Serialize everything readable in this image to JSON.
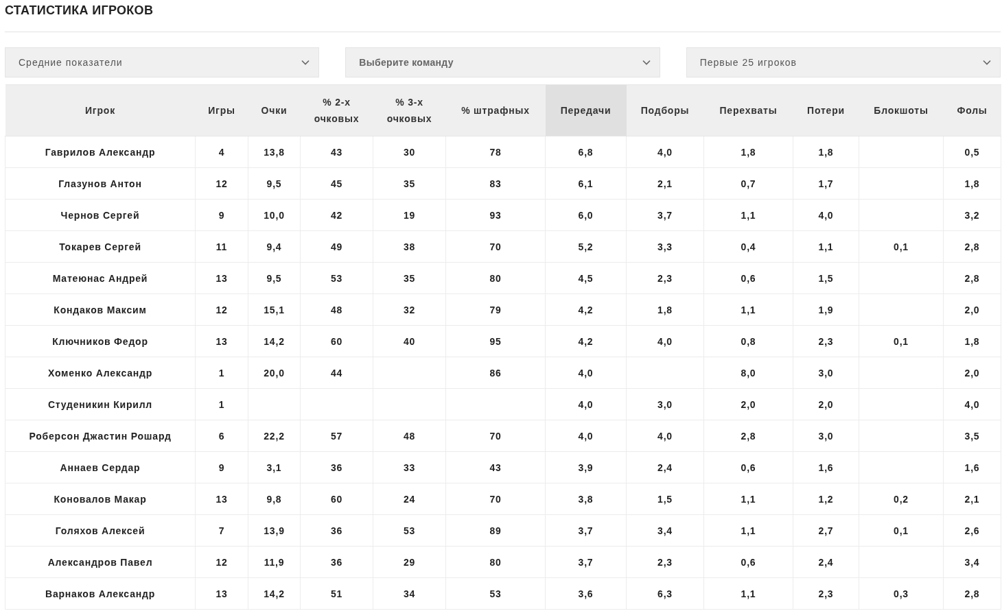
{
  "title": "СТАТИСТИКА ИГРОКОВ",
  "filters": [
    {
      "value": "Средние показатели"
    },
    {
      "placeholder": "Выберите команду"
    },
    {
      "value": "Первые 25 игроков"
    }
  ],
  "table": {
    "columns": [
      {
        "label": "Игрок",
        "selected": false
      },
      {
        "label": "Игры",
        "selected": false
      },
      {
        "label": "Очки",
        "selected": false
      },
      {
        "label": "% 2-х очковых",
        "selected": false
      },
      {
        "label": "% 3-х очковых",
        "selected": false
      },
      {
        "label": "% штрафных",
        "selected": false
      },
      {
        "label": "Передачи",
        "selected": true
      },
      {
        "label": "Подборы",
        "selected": false
      },
      {
        "label": "Перехваты",
        "selected": false
      },
      {
        "label": "Потери",
        "selected": false
      },
      {
        "label": "Блокшоты",
        "selected": false
      },
      {
        "label": "Фолы",
        "selected": false
      }
    ],
    "rows": [
      [
        "Гаврилов Александр",
        "4",
        "13,8",
        "43",
        "30",
        "78",
        "6,8",
        "4,0",
        "1,8",
        "1,8",
        null,
        "0,5"
      ],
      [
        "Глазунов Антон",
        "12",
        "9,5",
        "45",
        "35",
        "83",
        "6,1",
        "2,1",
        "0,7",
        "1,7",
        null,
        "1,8"
      ],
      [
        "Чернов Сергей",
        "9",
        "10,0",
        "42",
        "19",
        "93",
        "6,0",
        "3,7",
        "1,1",
        "4,0",
        null,
        "3,2"
      ],
      [
        "Токарев Сергей",
        "11",
        "9,4",
        "49",
        "38",
        "70",
        "5,2",
        "3,3",
        "0,4",
        "1,1",
        "0,1",
        "2,8"
      ],
      [
        "Матеюнас Андрей",
        "13",
        "9,5",
        "53",
        "35",
        "80",
        "4,5",
        "2,3",
        "0,6",
        "1,5",
        null,
        "2,8"
      ],
      [
        "Кондаков Максим",
        "12",
        "15,1",
        "48",
        "32",
        "79",
        "4,2",
        "1,8",
        "1,1",
        "1,9",
        null,
        "2,0"
      ],
      [
        "Ключников Федор",
        "13",
        "14,2",
        "60",
        "40",
        "95",
        "4,2",
        "4,0",
        "0,8",
        "2,3",
        "0,1",
        "1,8"
      ],
      [
        "Хоменко Александр",
        "1",
        "20,0",
        "44",
        null,
        "86",
        "4,0",
        null,
        "8,0",
        "3,0",
        null,
        "2,0"
      ],
      [
        "Студеникин Кирилл",
        "1",
        null,
        null,
        null,
        null,
        "4,0",
        "3,0",
        "2,0",
        "2,0",
        null,
        "4,0"
      ],
      [
        "Роберсон Джастин Рошард",
        "6",
        "22,2",
        "57",
        "48",
        "70",
        "4,0",
        "4,0",
        "2,8",
        "3,0",
        null,
        "3,5"
      ],
      [
        "Аннаев Сердар",
        "9",
        "3,1",
        "36",
        "33",
        "43",
        "3,9",
        "2,4",
        "0,6",
        "1,6",
        null,
        "1,6"
      ],
      [
        "Коновалов Макар",
        "13",
        "9,8",
        "60",
        "24",
        "70",
        "3,8",
        "1,5",
        "1,1",
        "1,2",
        "0,2",
        "2,1"
      ],
      [
        "Голяхов Алексей",
        "7",
        "13,9",
        "36",
        "53",
        "89",
        "3,7",
        "3,4",
        "1,1",
        "2,7",
        "0,1",
        "2,6"
      ],
      [
        "Александров Павел",
        "12",
        "11,9",
        "36",
        "29",
        "80",
        "3,7",
        "2,3",
        "0,6",
        "2,4",
        null,
        "3,4"
      ],
      [
        "Варнаков Александр",
        "13",
        "14,2",
        "51",
        "34",
        "53",
        "3,6",
        "6,3",
        "1,1",
        "2,3",
        "0,3",
        "2,8"
      ]
    ]
  }
}
